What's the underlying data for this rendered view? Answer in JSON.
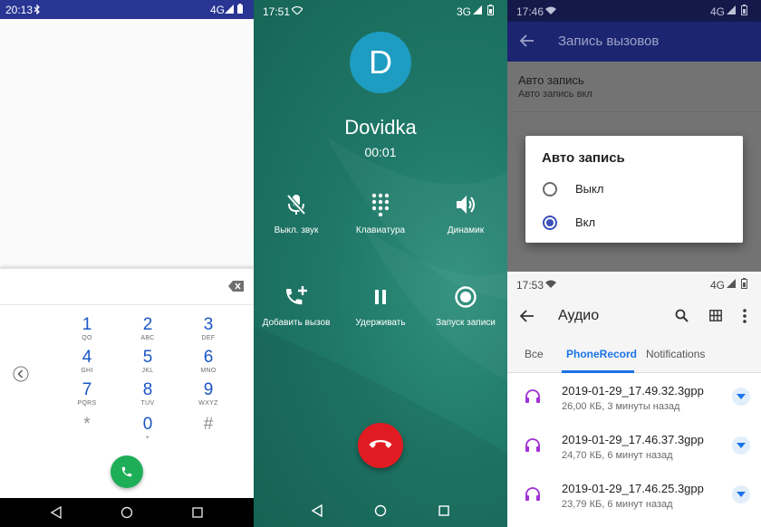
{
  "dialer": {
    "status_time": "20:13",
    "status_net": "4G",
    "keys": [
      {
        "digit": "1",
        "letters": "QO"
      },
      {
        "digit": "2",
        "letters": "ABC"
      },
      {
        "digit": "3",
        "letters": "DEF"
      },
      {
        "digit": "4",
        "letters": "GHI"
      },
      {
        "digit": "5",
        "letters": "JKL"
      },
      {
        "digit": "6",
        "letters": "MNO"
      },
      {
        "digit": "7",
        "letters": "PQRS"
      },
      {
        "digit": "8",
        "letters": "TUV"
      },
      {
        "digit": "9",
        "letters": "WXYZ"
      },
      {
        "digit": "*",
        "letters": ""
      },
      {
        "digit": "0",
        "letters": "+"
      },
      {
        "digit": "#",
        "letters": ""
      }
    ],
    "call_button_color": "#1fae58"
  },
  "call": {
    "status_time": "17:51",
    "status_net": "3G",
    "avatar_letter": "D",
    "contact_name": "Dovidka",
    "duration": "00:01",
    "buttons": [
      {
        "label": "Выкл. звук",
        "icon": "mic-off-icon"
      },
      {
        "label": "Клавиатура",
        "icon": "dialpad-icon"
      },
      {
        "label": "Динамик",
        "icon": "speaker-icon"
      },
      {
        "label": "Добавить вызов",
        "icon": "add-call-icon"
      },
      {
        "label": "Удерживать",
        "icon": "pause-icon"
      },
      {
        "label": "Запуск записи",
        "icon": "record-icon"
      }
    ],
    "end_call_color": "#e11b22"
  },
  "settings": {
    "status_time": "17:46",
    "status_net": "4G",
    "title": "Запись вызовов",
    "pref_title": "Авто запись",
    "pref_summary": "Авто запись вкл",
    "dialog_title": "Авто запись",
    "options": [
      {
        "label": "Выкл",
        "selected": false
      },
      {
        "label": "Вкл",
        "selected": true
      }
    ]
  },
  "audio": {
    "status_time": "17:53",
    "status_net": "4G",
    "title": "Аудио",
    "tabs": [
      "Все",
      "PhoneRecord",
      "Notifications"
    ],
    "active_tab": "PhoneRecord",
    "files": [
      {
        "name": "2019-01-29_17.49.32.3gpp",
        "meta": "26,00 КБ, 3 минуты назад"
      },
      {
        "name": "2019-01-29_17.46.37.3gpp",
        "meta": "24,70 КБ, 6 минут назад"
      },
      {
        "name": "2019-01-29_17.46.25.3gpp",
        "meta": "23,79 КБ, 6 минут назад"
      }
    ],
    "accent_color": "#1a73e8",
    "file_icon_color": "#a12fd6"
  }
}
